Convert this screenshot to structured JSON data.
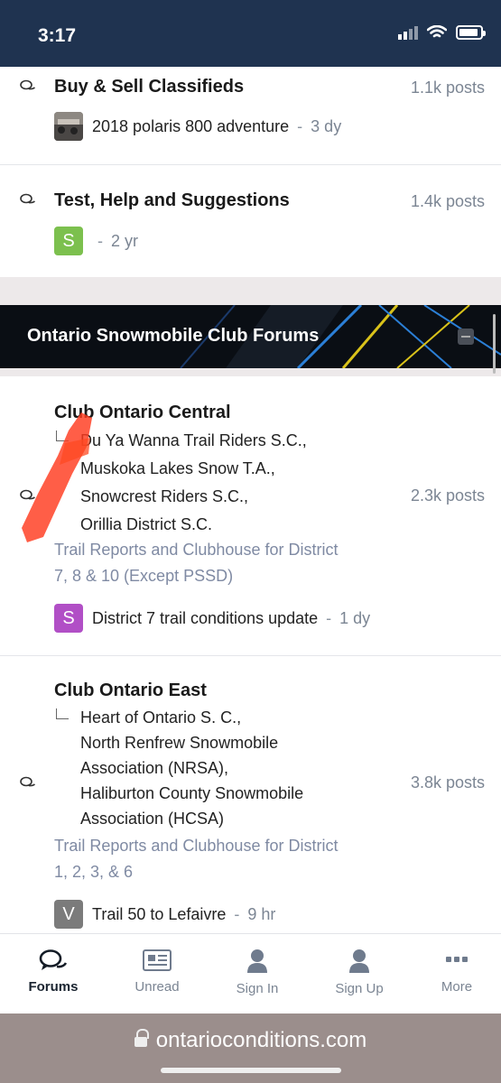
{
  "status_bar": {
    "time": "3:17"
  },
  "forums_top": [
    {
      "title": "Buy & Sell Classifieds",
      "posts": "1.1k posts",
      "latest_title": "2018 polaris 800 adventure",
      "latest_time": "3 dy"
    },
    {
      "title": "Test, Help and Suggestions",
      "posts": "1.4k posts",
      "avatar_letter": "S",
      "latest_time": "2 yr"
    }
  ],
  "banner": {
    "label": "Ontario Snowmobile Club Forums"
  },
  "club_central": {
    "title": "Club Ontario Central",
    "subforums": [
      "Du Ya Wanna Trail Riders S.C.,",
      "Muskoka Lakes Snow T.A.,",
      "Snowcrest Riders S.C.,",
      "Orillia District S.C."
    ],
    "posts": "2.3k posts",
    "desc_line1": "Trail Reports and Clubhouse for District",
    "desc_line2": "7, 8 & 10 (Except PSSD)",
    "avatar_letter": "S",
    "latest_title": "District 7 trail conditions update",
    "latest_time": "1 dy"
  },
  "club_east": {
    "title": "Club Ontario East",
    "subforums": [
      "Heart of Ontario S. C.,",
      "North Renfrew Snowmobile",
      "Association (NRSA),",
      "Haliburton County Snowmobile",
      "Association (HCSA)"
    ],
    "posts": "3.8k posts",
    "desc_line1": "Trail Reports and Clubhouse for District",
    "desc_line2": "1, 2, 3, & 6",
    "avatar_letter": "V",
    "latest_title": "Trail 50 to Lefaivre",
    "latest_time": "9 hr"
  },
  "tabs": [
    {
      "label": "Forums",
      "icon": "chat-bubbles-icon",
      "active": true
    },
    {
      "label": "Unread",
      "icon": "newspaper-icon"
    },
    {
      "label": "Sign In",
      "icon": "person-icon"
    },
    {
      "label": "Sign Up",
      "icon": "person-icon"
    },
    {
      "label": "More",
      "icon": "dots-icon"
    }
  ],
  "browser": {
    "url": "ontarioconditions.com"
  },
  "colors": {
    "status_bar_bg": "#1f3350",
    "banner_bg": "#0a0e14",
    "accent_green": "#7cc04e",
    "accent_purple": "#b14fc6",
    "accent_gray": "#7b7b7b",
    "marker_orange": "#ff3b1e"
  }
}
